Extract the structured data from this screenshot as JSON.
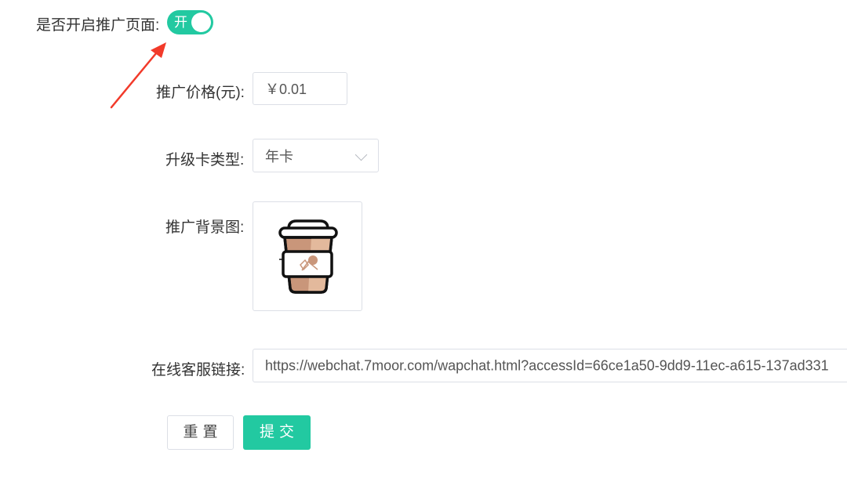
{
  "form": {
    "promo_toggle": {
      "label": "是否开启推广页面:",
      "state_text": "开",
      "enabled": true
    },
    "price": {
      "label": "推广价格(元):",
      "value": "￥0.01"
    },
    "card_type": {
      "label": "升级卡类型:",
      "selected": "年卡"
    },
    "background": {
      "label": "推广背景图:",
      "image_icon": "coffee-cup-icon"
    },
    "service_link": {
      "label": "在线客服链接:",
      "value": "https://webchat.7moor.com/wapchat.html?accessId=66ce1a50-9dd9-11ec-a615-137ad331"
    },
    "buttons": {
      "reset": "重置",
      "submit": "提交"
    }
  },
  "annotation": {
    "arrow_icon": "red-arrow-icon",
    "color": "#f23a2a"
  },
  "colors": {
    "accent": "#22c9a1",
    "border": "#dcdfe6",
    "text": "#333333"
  }
}
